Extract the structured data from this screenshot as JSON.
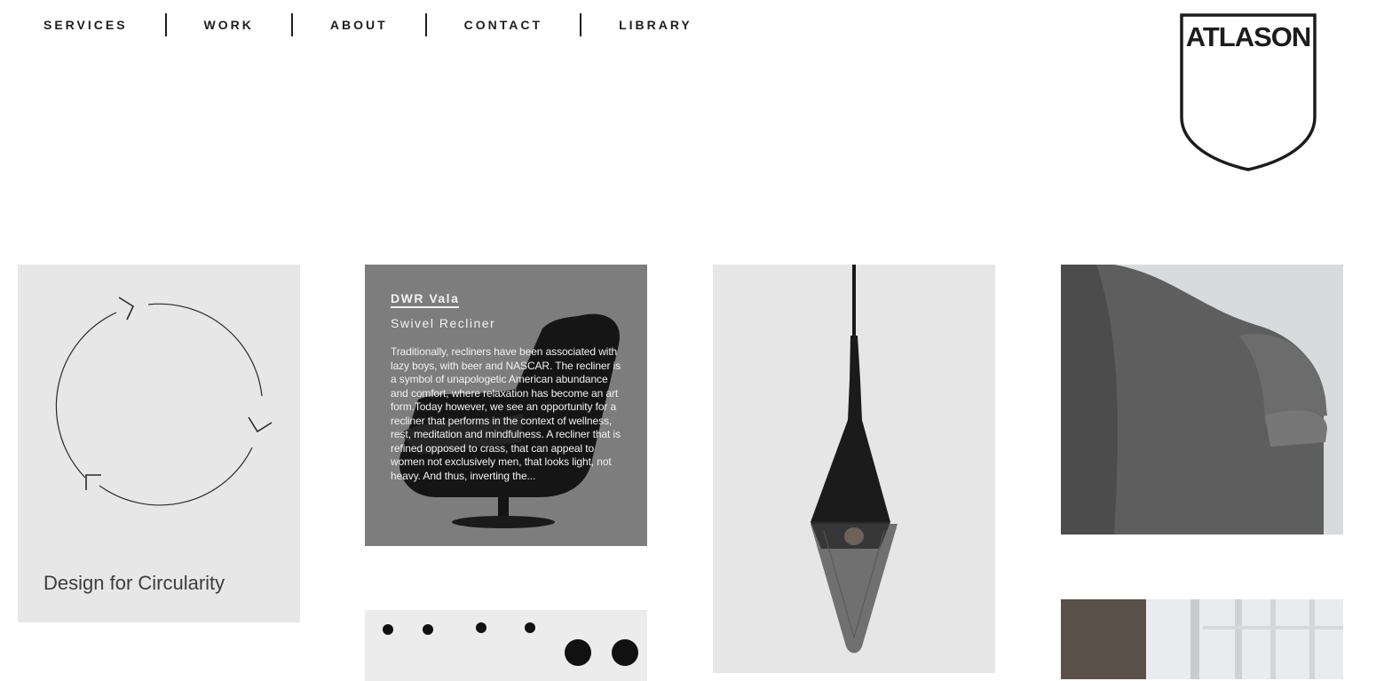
{
  "nav": {
    "items": [
      "SERVICES",
      "WORK",
      "ABOUT",
      "CONTACT",
      "LIBRARY"
    ]
  },
  "logo": {
    "text": "ATLASON"
  },
  "tiles": {
    "circularity": {
      "caption": "Design for Circularity"
    },
    "recliner": {
      "title": "DWR Vala",
      "subtitle": "Swivel Recliner",
      "description": "Traditionally, recliners have been associated with lazy boys, with beer and NASCAR. The recliner is a symbol of unapologetic American abundance and comfort, where relaxation has become an art form.Today however, we see an opportunity for a recliner that performs in the context of wellness, rest, meditation and mindfulness.  A recliner that is refined opposed to crass, that can appeal to women not exclusively men, that looks light, not heavy. And thus, inverting the..."
    }
  },
  "colors": {
    "text": "#1e1e1e",
    "tile_light": "#e7e7e7",
    "tile_dark": "#7d7d7d"
  }
}
